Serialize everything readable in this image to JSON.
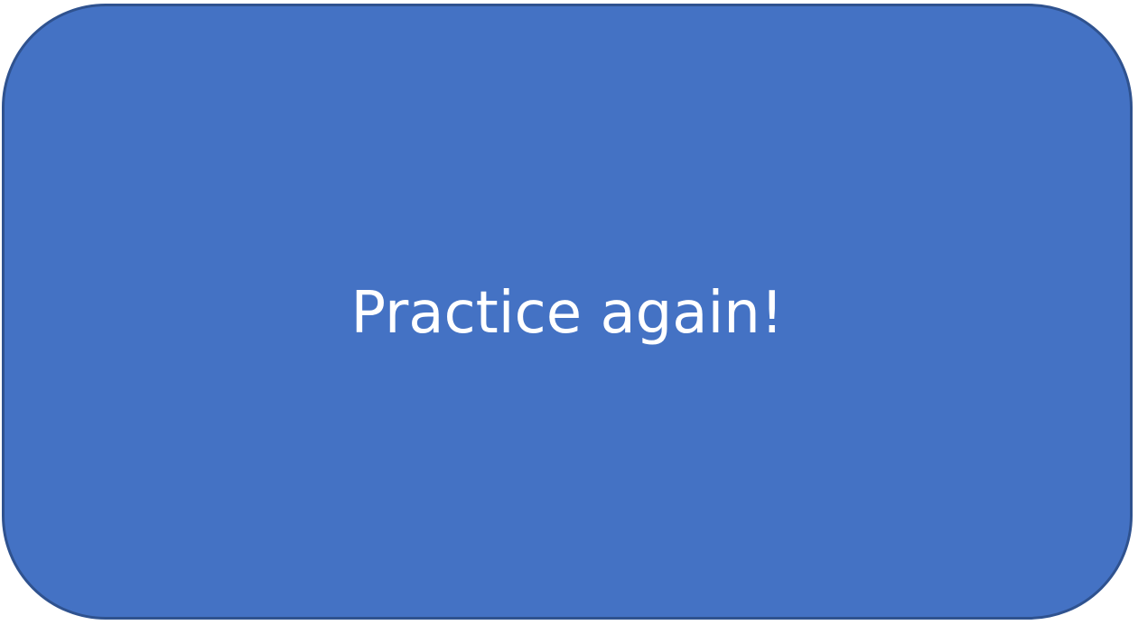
{
  "button": {
    "label": "Practice again!",
    "fill_color": "#4472c4",
    "border_color": "#2f528f",
    "text_color": "#ffffff"
  }
}
